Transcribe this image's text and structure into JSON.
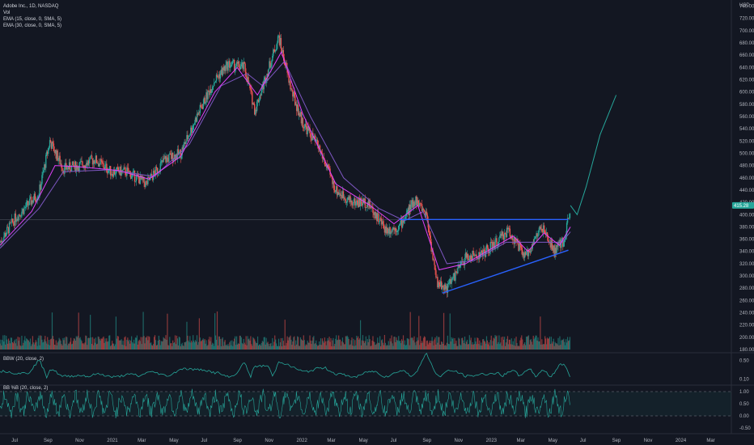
{
  "header": {
    "symbol_line": "Adobe Inc., 1D, NASDAQ",
    "vol_label": "Vol",
    "ema1_label": "EMA (15, close, 0, SMA, 5)",
    "ema2_label": "EMA (30, close, 0, SMA, 5)"
  },
  "panes": {
    "bbw_label": "BBW (20, close, 2)",
    "bbpb_label": "BB %B (20, close, 2)"
  },
  "colors": {
    "background": "#131722",
    "up_candle": "#26a69a",
    "down_candle": "#ef5350",
    "ema_fast": "#e040fb",
    "ema_slow": "#7e57c2",
    "trendline": "#2962ff",
    "projection": "#26a69a",
    "price_badge": "#26a69a",
    "bbw_line": "#26a69a",
    "bbpb_line": "#26a69a"
  },
  "chart_data": {
    "type": "candlestick",
    "title": "Adobe Inc., 1D, NASDAQ",
    "current_price_label": "415.28",
    "y_axis": {
      "unit": "USD",
      "ticks": [
        "740.00",
        "720.00",
        "700.00",
        "680.00",
        "660.00",
        "640.00",
        "620.00",
        "600.00",
        "580.00",
        "560.00",
        "540.00",
        "520.00",
        "500.00",
        "480.00",
        "460.00",
        "440.00",
        "420.00",
        "400.00",
        "380.00",
        "360.00",
        "340.00",
        "320.00",
        "300.00",
        "280.00",
        "260.00",
        "240.00",
        "220.00",
        "200.00",
        "180.00"
      ],
      "range": [
        180,
        750
      ]
    },
    "x_axis": {
      "ticks": [
        "Jul",
        "Sep",
        "Nov",
        "2021",
        "Mar",
        "May",
        "Jul",
        "Sep",
        "Nov",
        "2022",
        "Mar",
        "May",
        "Jul",
        "Sep",
        "Nov",
        "2023",
        "Mar",
        "May",
        "Jul",
        "Sep",
        "Nov",
        "2024",
        "Mar"
      ],
      "range": [
        "2020-06-01",
        "2024-04-10"
      ]
    },
    "price_path": [
      [
        "2020-06-01",
        355
      ],
      [
        "2020-07-01",
        395
      ],
      [
        "2020-08-15",
        435
      ],
      [
        "2020-09-05",
        520
      ],
      [
        "2020-10-01",
        475
      ],
      [
        "2020-11-01",
        480
      ],
      [
        "2020-12-01",
        490
      ],
      [
        "2021-01-01",
        470
      ],
      [
        "2021-02-01",
        470
      ],
      [
        "2021-03-10",
        450
      ],
      [
        "2021-04-15",
        490
      ],
      [
        "2021-05-15",
        500
      ],
      [
        "2021-06-15",
        560
      ],
      [
        "2021-07-20",
        620
      ],
      [
        "2021-08-15",
        645
      ],
      [
        "2021-09-15",
        640
      ],
      [
        "2021-10-05",
        570
      ],
      [
        "2021-11-05",
        650
      ],
      [
        "2021-11-20",
        690
      ],
      [
        "2021-12-15",
        600
      ],
      [
        "2022-01-05",
        550
      ],
      [
        "2022-02-05",
        510
      ],
      [
        "2022-03-10",
        440
      ],
      [
        "2022-04-10",
        420
      ],
      [
        "2022-05-10",
        420
      ],
      [
        "2022-06-15",
        375
      ],
      [
        "2022-07-10",
        380
      ],
      [
        "2022-08-10",
        425
      ],
      [
        "2022-09-01",
        400
      ],
      [
        "2022-09-20",
        290
      ],
      [
        "2022-10-10",
        280
      ],
      [
        "2022-11-15",
        330
      ],
      [
        "2022-12-15",
        335
      ],
      [
        "2023-01-15",
        355
      ],
      [
        "2023-02-05",
        375
      ],
      [
        "2023-03-10",
        330
      ],
      [
        "2023-04-10",
        380
      ],
      [
        "2023-05-05",
        340
      ],
      [
        "2023-05-25",
        360
      ],
      [
        "2023-06-05",
        415
      ]
    ],
    "ema_fast": [
      [
        "2020-06-01",
        350
      ],
      [
        "2020-08-01",
        405
      ],
      [
        "2020-09-15",
        480
      ],
      [
        "2020-11-01",
        478
      ],
      [
        "2021-01-15",
        472
      ],
      [
        "2021-03-15",
        458
      ],
      [
        "2021-05-15",
        495
      ],
      [
        "2021-07-20",
        600
      ],
      [
        "2021-09-01",
        640
      ],
      [
        "2021-10-10",
        595
      ],
      [
        "2021-11-25",
        665
      ],
      [
        "2022-01-05",
        565
      ],
      [
        "2022-03-10",
        450
      ],
      [
        "2022-05-15",
        415
      ],
      [
        "2022-06-30",
        385
      ],
      [
        "2022-08-15",
        415
      ],
      [
        "2022-09-25",
        310
      ],
      [
        "2022-11-15",
        320
      ],
      [
        "2023-01-15",
        350
      ],
      [
        "2023-02-15",
        365
      ],
      [
        "2023-03-15",
        340
      ],
      [
        "2023-04-15",
        370
      ],
      [
        "2023-05-15",
        350
      ],
      [
        "2023-06-05",
        380
      ]
    ],
    "ema_slow": [
      [
        "2020-06-01",
        345
      ],
      [
        "2020-08-15",
        410
      ],
      [
        "2020-10-01",
        470
      ],
      [
        "2021-01-01",
        473
      ],
      [
        "2021-03-25",
        462
      ],
      [
        "2021-06-01",
        515
      ],
      [
        "2021-08-01",
        610
      ],
      [
        "2021-09-20",
        630
      ],
      [
        "2021-10-20",
        610
      ],
      [
        "2021-12-01",
        650
      ],
      [
        "2022-01-20",
        560
      ],
      [
        "2022-03-25",
        460
      ],
      [
        "2022-06-01",
        410
      ],
      [
        "2022-07-20",
        390
      ],
      [
        "2022-08-25",
        405
      ],
      [
        "2022-10-10",
        320
      ],
      [
        "2022-12-01",
        325
      ],
      [
        "2023-02-01",
        355
      ],
      [
        "2023-04-01",
        355
      ],
      [
        "2023-05-20",
        355
      ],
      [
        "2023-06-05",
        372
      ]
    ],
    "horizontal_level": 392,
    "resistance_line": [
      [
        "2022-07-10",
        392
      ],
      [
        "2023-06-01",
        392
      ]
    ],
    "support_line": [
      [
        "2022-10-01",
        272
      ],
      [
        "2023-06-01",
        342
      ]
    ],
    "projection": [
      [
        "2023-06-05",
        415
      ],
      [
        "2023-06-18",
        400
      ],
      [
        "2023-07-05",
        445
      ],
      [
        "2023-08-01",
        530
      ],
      [
        "2023-09-01",
        595
      ]
    ],
    "bbw_label": "BBW (20, close, 2)",
    "bbw_ticks": [
      "0.50",
      "0.10"
    ],
    "bbpb_label": "BB %B (20, close, 2)",
    "bbpb_ticks": [
      "1.00",
      "0.50",
      "0.00",
      "-0.50"
    ]
  }
}
